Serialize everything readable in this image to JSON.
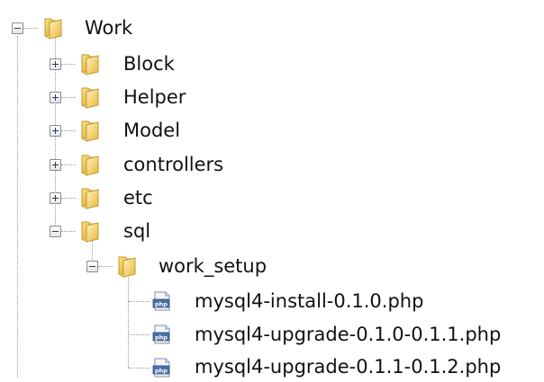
{
  "tree": {
    "root": {
      "label": "Work",
      "icon": "folder-icon",
      "expanded": true
    },
    "children": [
      {
        "label": "Block",
        "icon": "folder-icon",
        "expanded": false
      },
      {
        "label": "Helper",
        "icon": "folder-icon",
        "expanded": false
      },
      {
        "label": "Model",
        "icon": "folder-icon",
        "expanded": false
      },
      {
        "label": "controllers",
        "icon": "folder-icon",
        "expanded": false
      },
      {
        "label": "etc",
        "icon": "folder-icon",
        "expanded": false
      },
      {
        "label": "sql",
        "icon": "folder-icon",
        "expanded": true
      }
    ],
    "sql_children": [
      {
        "label": "work_setup",
        "icon": "folder-icon",
        "expanded": true
      }
    ],
    "files": [
      {
        "label": "mysql4-install-0.1.0.php",
        "icon": "php-file-icon"
      },
      {
        "label": "mysql4-upgrade-0.1.0-0.1.1.php",
        "icon": "php-file-icon"
      },
      {
        "label": "mysql4-upgrade-0.1.1-0.1.2.php",
        "icon": "php-file-icon"
      }
    ]
  },
  "colors": {
    "folder_light": "#fbe7a1",
    "folder_dark": "#e8b62f",
    "folder_outline": "#c39a2a",
    "php_blue": "#4a6fa5",
    "tree_line": "#9a9a9a"
  }
}
